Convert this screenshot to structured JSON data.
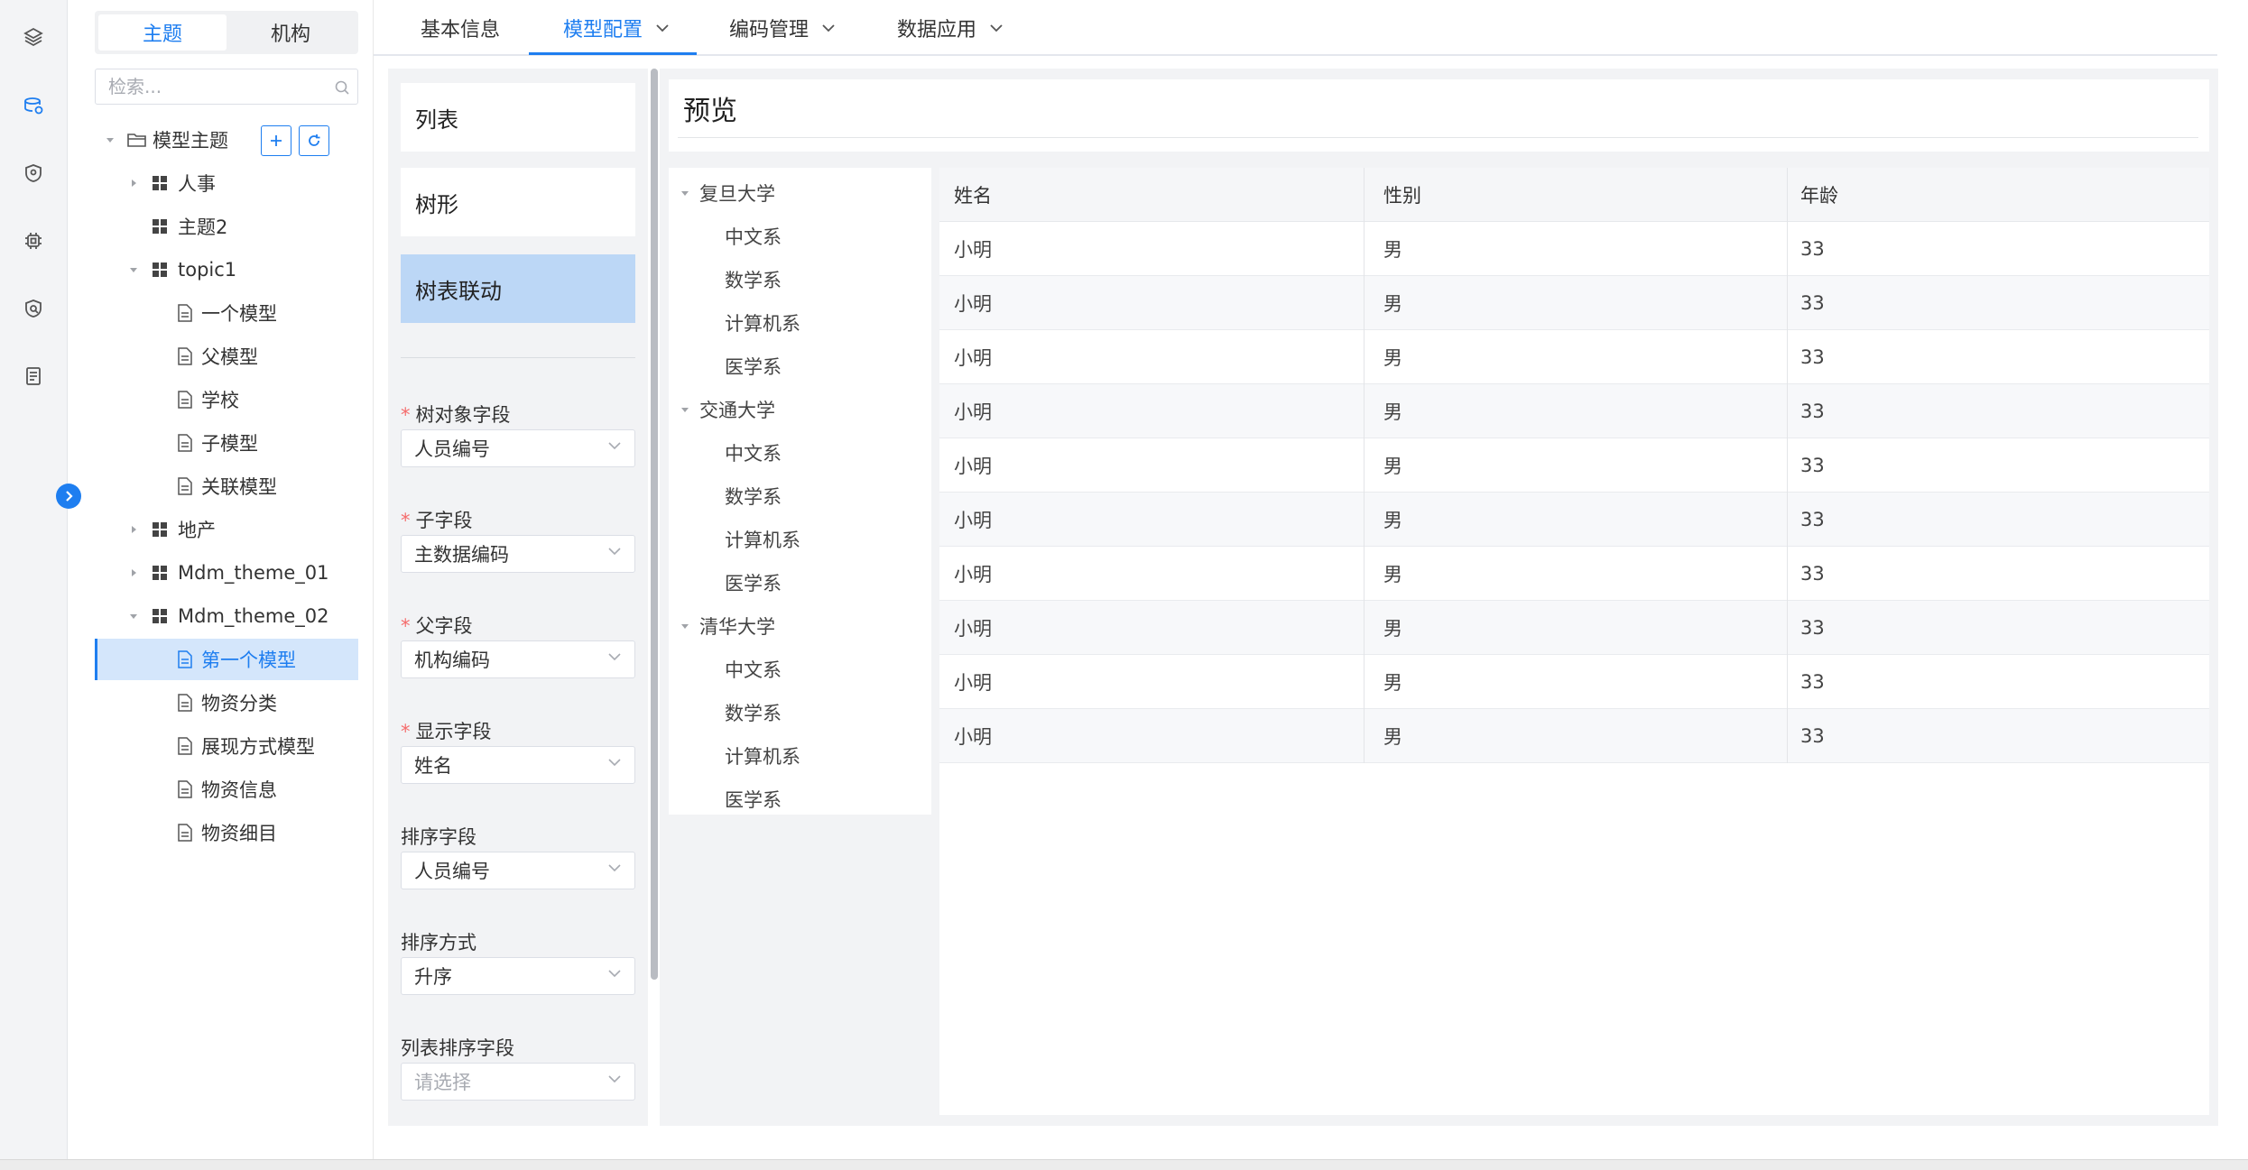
{
  "rail": {
    "icons": [
      "layers-icon",
      "database-icon",
      "shield-icon",
      "chip-icon",
      "security-icon",
      "document-icon"
    ]
  },
  "sidebar": {
    "segments": [
      "主题",
      "机构"
    ],
    "search_placeholder": "检索...",
    "tree": [
      {
        "label": "模型主题",
        "type": "folder",
        "level": 0,
        "expanded": true
      },
      {
        "label": "人事",
        "type": "theme",
        "level": 1,
        "expanded": false
      },
      {
        "label": "主题2",
        "type": "theme",
        "level": 1
      },
      {
        "label": "topic1",
        "type": "theme",
        "level": 1,
        "expanded": true
      },
      {
        "label": "一个模型",
        "type": "model",
        "level": 2
      },
      {
        "label": "父模型",
        "type": "model",
        "level": 2
      },
      {
        "label": "学校",
        "type": "model",
        "level": 2
      },
      {
        "label": "子模型",
        "type": "model",
        "level": 2
      },
      {
        "label": "关联模型",
        "type": "model",
        "level": 2
      },
      {
        "label": "地产",
        "type": "theme",
        "level": 1,
        "expanded": false
      },
      {
        "label": "Mdm_theme_01",
        "type": "theme",
        "level": 1,
        "expanded": false
      },
      {
        "label": "Mdm_theme_02",
        "type": "theme",
        "level": 1,
        "expanded": true
      },
      {
        "label": "第一个模型",
        "type": "model",
        "level": 2,
        "selected": true
      },
      {
        "label": "物资分类",
        "type": "model",
        "level": 2
      },
      {
        "label": "展现方式模型",
        "type": "model",
        "level": 2
      },
      {
        "label": "物资信息",
        "type": "model",
        "level": 2
      },
      {
        "label": "物资细目",
        "type": "model",
        "level": 2
      }
    ]
  },
  "tabs": [
    {
      "label": "基本信息",
      "dropdown": false
    },
    {
      "label": "模型配置",
      "dropdown": true,
      "active": true
    },
    {
      "label": "编码管理",
      "dropdown": true
    },
    {
      "label": "数据应用",
      "dropdown": true
    }
  ],
  "config": {
    "types": [
      "列表",
      "树形",
      "树表联动"
    ],
    "active_type": "树表联动",
    "fields": [
      {
        "label": "树对象字段",
        "required": true,
        "value": "人员编号"
      },
      {
        "label": "子字段",
        "required": true,
        "value": "主数据编码"
      },
      {
        "label": "父字段",
        "required": true,
        "value": "机构编码"
      },
      {
        "label": "显示字段",
        "required": true,
        "value": "姓名"
      },
      {
        "label": "排序字段",
        "required": false,
        "value": "人员编号"
      },
      {
        "label": "排序方式",
        "required": false,
        "value": "升序"
      },
      {
        "label": "列表排序字段",
        "required": false,
        "value": "",
        "placeholder": "请选择"
      }
    ]
  },
  "preview": {
    "title": "预览",
    "tree": [
      {
        "label": "复旦大学",
        "children": [
          "中文系",
          "数学系",
          "计算机系",
          "医学系"
        ]
      },
      {
        "label": "交通大学",
        "children": [
          "中文系",
          "数学系",
          "计算机系",
          "医学系"
        ]
      },
      {
        "label": "清华大学",
        "children": [
          "中文系",
          "数学系",
          "计算机系",
          "医学系"
        ]
      }
    ],
    "table": {
      "columns": [
        "姓名",
        "性别",
        "年龄"
      ],
      "rows": [
        [
          "小明",
          "男",
          "33"
        ],
        [
          "小明",
          "男",
          "33"
        ],
        [
          "小明",
          "男",
          "33"
        ],
        [
          "小明",
          "男",
          "33"
        ],
        [
          "小明",
          "男",
          "33"
        ],
        [
          "小明",
          "男",
          "33"
        ],
        [
          "小明",
          "男",
          "33"
        ],
        [
          "小明",
          "男",
          "33"
        ],
        [
          "小明",
          "男",
          "33"
        ],
        [
          "小明",
          "男",
          "33"
        ]
      ]
    }
  },
  "colors": {
    "accent": "#1e7ef0",
    "active_card": "#bcd7f6",
    "required": "#f56c6c"
  }
}
